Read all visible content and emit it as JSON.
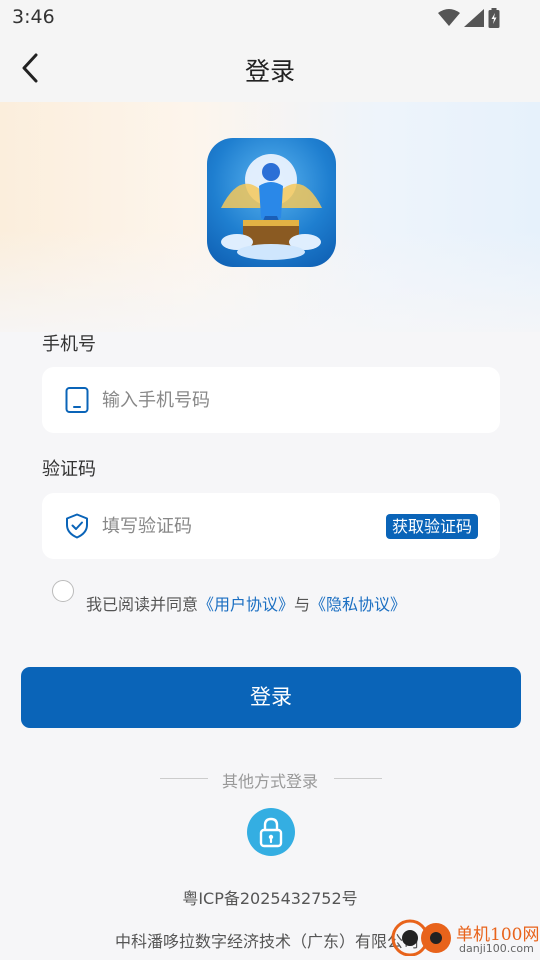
{
  "status_bar": {
    "time": "3:46"
  },
  "header": {
    "title": "登录"
  },
  "form": {
    "phone_label": "手机号",
    "phone_placeholder": "输入手机号码",
    "code_label": "验证码",
    "code_placeholder": "填写验证码",
    "get_code_label": "获取验证码"
  },
  "agreement": {
    "prefix": "我已阅读并同意",
    "user_link": "《用户协议》",
    "connector": "与",
    "privacy_link": "《隐私协议》",
    "checked": false
  },
  "login_button": "登录",
  "other_login": {
    "label": "其他方式登录"
  },
  "footer": {
    "icp": "粤ICP备2025432752号",
    "company": "中科潘哆拉数字经济技术（广东）有限公司"
  },
  "watermark": {
    "name": "单机100网",
    "url": "danji100.com"
  },
  "colors": {
    "primary": "#0a64b8",
    "link": "#1b6fc2",
    "alt_login": "#34aee2"
  },
  "icons": {
    "back": "chevron-left-icon",
    "phone": "phone-icon",
    "shield": "shield-check-icon",
    "lock": "lock-icon",
    "wifi": "wifi-icon",
    "signal": "signal-icon",
    "battery": "battery-icon"
  }
}
